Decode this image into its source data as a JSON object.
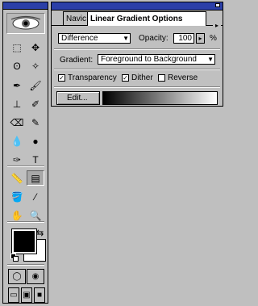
{
  "panel": {
    "tabs": [
      {
        "label": "Navic",
        "active": false
      },
      {
        "label": "Linear Gradient Options",
        "active": true
      }
    ],
    "mode": {
      "value": "Difference"
    },
    "opacity": {
      "label": "Opacity:",
      "value": "100",
      "unit": "%"
    },
    "gradient": {
      "label": "Gradient:",
      "value": "Foreground to Background"
    },
    "options": [
      {
        "label": "Transparency",
        "checked": true
      },
      {
        "label": "Dither",
        "checked": true
      },
      {
        "label": "Reverse",
        "checked": false
      }
    ],
    "edit_label": "Edit..."
  },
  "toolbox": {
    "tools": [
      {
        "name": "marquee-tool",
        "glyph": "⬚"
      },
      {
        "name": "move-tool",
        "glyph": "✥"
      },
      {
        "name": "lasso-tool",
        "glyph": "ʘ"
      },
      {
        "name": "magic-wand-tool",
        "glyph": "✧"
      },
      {
        "name": "airbrush-tool",
        "glyph": "✒"
      },
      {
        "name": "paintbrush-tool",
        "glyph": "🖌"
      },
      {
        "name": "rubber-stamp-tool",
        "glyph": "⊥"
      },
      {
        "name": "history-brush-tool",
        "glyph": "✐"
      },
      {
        "name": "eraser-tool",
        "glyph": "⌫"
      },
      {
        "name": "pencil-tool",
        "glyph": "✎"
      },
      {
        "name": "blur-tool",
        "glyph": "💧"
      },
      {
        "name": "burn-tool",
        "glyph": "●"
      },
      {
        "name": "pen-tool",
        "glyph": "✑"
      },
      {
        "name": "type-tool",
        "glyph": "T"
      },
      {
        "name": "measure-tool",
        "glyph": "📏"
      },
      {
        "name": "gradient-tool",
        "glyph": "▤"
      },
      {
        "name": "paint-bucket-tool",
        "glyph": "🪣"
      },
      {
        "name": "eyedropper-tool",
        "glyph": "⁄"
      },
      {
        "name": "hand-tool",
        "glyph": "✋"
      },
      {
        "name": "zoom-tool",
        "glyph": "🔍"
      },
      {
        "name": "standard-mode-button",
        "glyph": "◯"
      },
      {
        "name": "quick-mask-mode-button",
        "glyph": "◉"
      },
      {
        "name": "standard-screen-button",
        "glyph": "▭"
      },
      {
        "name": "full-screen-menu-button",
        "glyph": "▣"
      },
      {
        "name": "full-screen-button",
        "glyph": "■"
      }
    ],
    "foreground_color": "#000000",
    "background_color": "#ffffff"
  }
}
